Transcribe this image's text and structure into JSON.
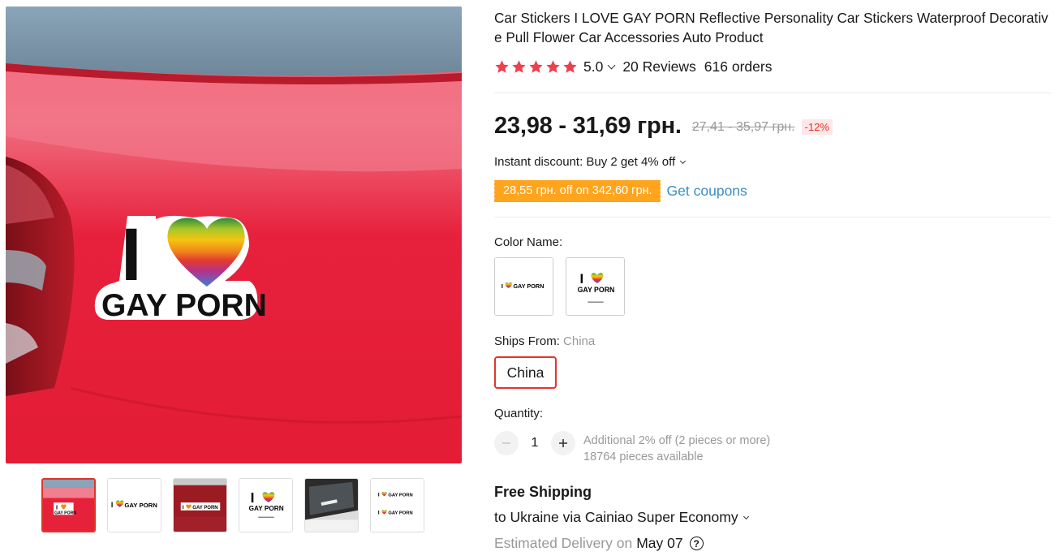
{
  "product": {
    "title": "Car Stickers I LOVE GAY PORN Reflective Personality Car Stickers Waterproof Decorative Pull Flower Car Accessories Auto Product",
    "rating": "5.0",
    "reviews": "20 Reviews",
    "orders": "616 orders",
    "star_color": "#ee3f4d"
  },
  "gallery": {
    "sticker_text_top": "I",
    "sticker_text_bottom": "GAY PORN",
    "thumbnails": [
      {
        "name": "car-rear-sticker",
        "active": true
      },
      {
        "name": "sticker-horizontal"
      },
      {
        "name": "sticker-on-red-car"
      },
      {
        "name": "sticker-stacked"
      },
      {
        "name": "sticker-on-car-window"
      },
      {
        "name": "sticker-double"
      }
    ]
  },
  "price": {
    "current": "23,98 - 31,69 грн.",
    "original": "27,41 - 35,97 грн.",
    "discount": "-12%",
    "accent": "#e1342b"
  },
  "promo": {
    "instant_discount": "Instant discount: Buy 2 get 4% off",
    "coupon": "28,55 грн. off on 342,60 грн.",
    "get_coupons": "Get coupons"
  },
  "options": {
    "color_label": "Color Name:",
    "ships_from_label": "Ships From:",
    "ships_from_value": "China",
    "ships_from_option": "China"
  },
  "quantity": {
    "label": "Quantity:",
    "value": "1",
    "additional": "Additional 2% off (2 pieces or more)",
    "available": "18764 pieces available"
  },
  "shipping": {
    "free": "Free Shipping",
    "to": "to Ukraine via Cainiao Super Economy",
    "estimated_label": "Estimated Delivery on",
    "date": "May 07",
    "help": "?"
  }
}
